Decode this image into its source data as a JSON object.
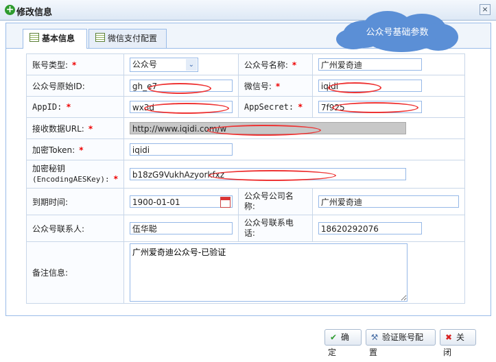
{
  "window": {
    "title": "修改信息",
    "close_glyph": "×"
  },
  "tabs": [
    {
      "label": "基本信息"
    },
    {
      "label": "微信支付配置"
    }
  ],
  "cloud_label": "公众号基础参数",
  "form": {
    "account_type": {
      "label": "账号类型:",
      "value": "公众号"
    },
    "mp_name": {
      "label": "公众号名称:",
      "value": "广州爱奇迪"
    },
    "original_id": {
      "label": "公众号原始ID:",
      "value": "gh_e7"
    },
    "wechat_id": {
      "label": "微信号:",
      "value": "iqidi"
    },
    "appid": {
      "label": "AppID:",
      "value": "wx3d"
    },
    "appsecret": {
      "label": "AppSecret:",
      "value": "7f925"
    },
    "url": {
      "label": "接收数据URL:",
      "value": "http://www.iqidi.com/w"
    },
    "token": {
      "label": "加密Token:",
      "value": "iqidi"
    },
    "aeskey": {
      "label_line1": "加密秘钥",
      "label_line2": "(EncodingAESKey):",
      "value": "b18zG9VukhAzyorkfxz"
    },
    "expire": {
      "label": "到期时间:",
      "value": "1900-01-01"
    },
    "company": {
      "label_line1": "公众号公司名",
      "label_line2": "称:",
      "value": "广州爱奇迪"
    },
    "contact": {
      "label": "公众号联系人:",
      "value": "伍华聪"
    },
    "phone": {
      "label_line1": "公众号联系电",
      "label_line2": "话:",
      "value": "18620292076"
    },
    "remark": {
      "label": "备注信息:",
      "value": "广州爱奇迪公众号-已验证"
    },
    "required_mark": "*"
  },
  "buttons": {
    "confirm": "确定",
    "verify": "验证账号配置",
    "close": "关闭"
  },
  "icons": {
    "title": "edit-plus-icon",
    "tab": "table-icon",
    "confirm": "checkmark-icon",
    "verify": "tools-icon",
    "close": "red-x-icon"
  },
  "colors": {
    "accent": "#99bbe8",
    "cloud": "#5b8fd6",
    "required": "#ee0000"
  }
}
